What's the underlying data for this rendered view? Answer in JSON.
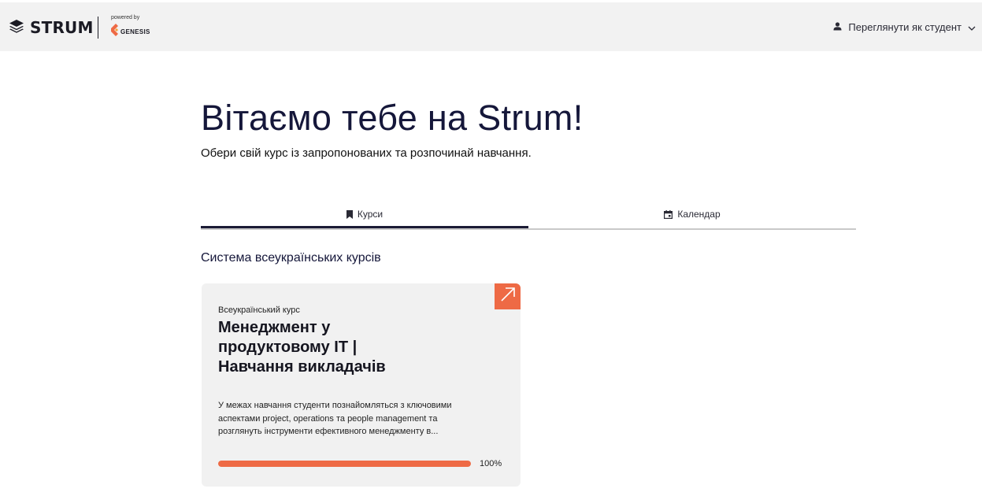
{
  "header": {
    "logo_text": "STRUM",
    "powered_by": "powered by",
    "partner": "GENESIS",
    "view_as_label": "Переглянути як студент"
  },
  "hero": {
    "title": "Вітаємо тебе на Strum!",
    "subtitle": "Обери свій курс із запропонованих та розпочинай навчання."
  },
  "tabs": [
    {
      "label": "Курси",
      "icon": "bookmark-icon",
      "active": true
    },
    {
      "label": "Календар",
      "icon": "calendar-icon",
      "active": false
    }
  ],
  "section": {
    "title": "Система всеукраїнських курсів"
  },
  "course_card": {
    "kind": "Всеукраїнський курс",
    "title": "Менеджмент у продуктовому ІТ | Навчання викладачів",
    "description": "У межах навчання студенти познайомляться з ключовими аспектами project, operations та people management та розглянуть інструменти ефективного менеджменту в...",
    "progress": 100,
    "progress_label": "100%"
  },
  "colors": {
    "accent": "#ee6a45",
    "header_bg": "#f2f2f2",
    "card_bg": "#f1f1f1",
    "title": "#15173a"
  }
}
